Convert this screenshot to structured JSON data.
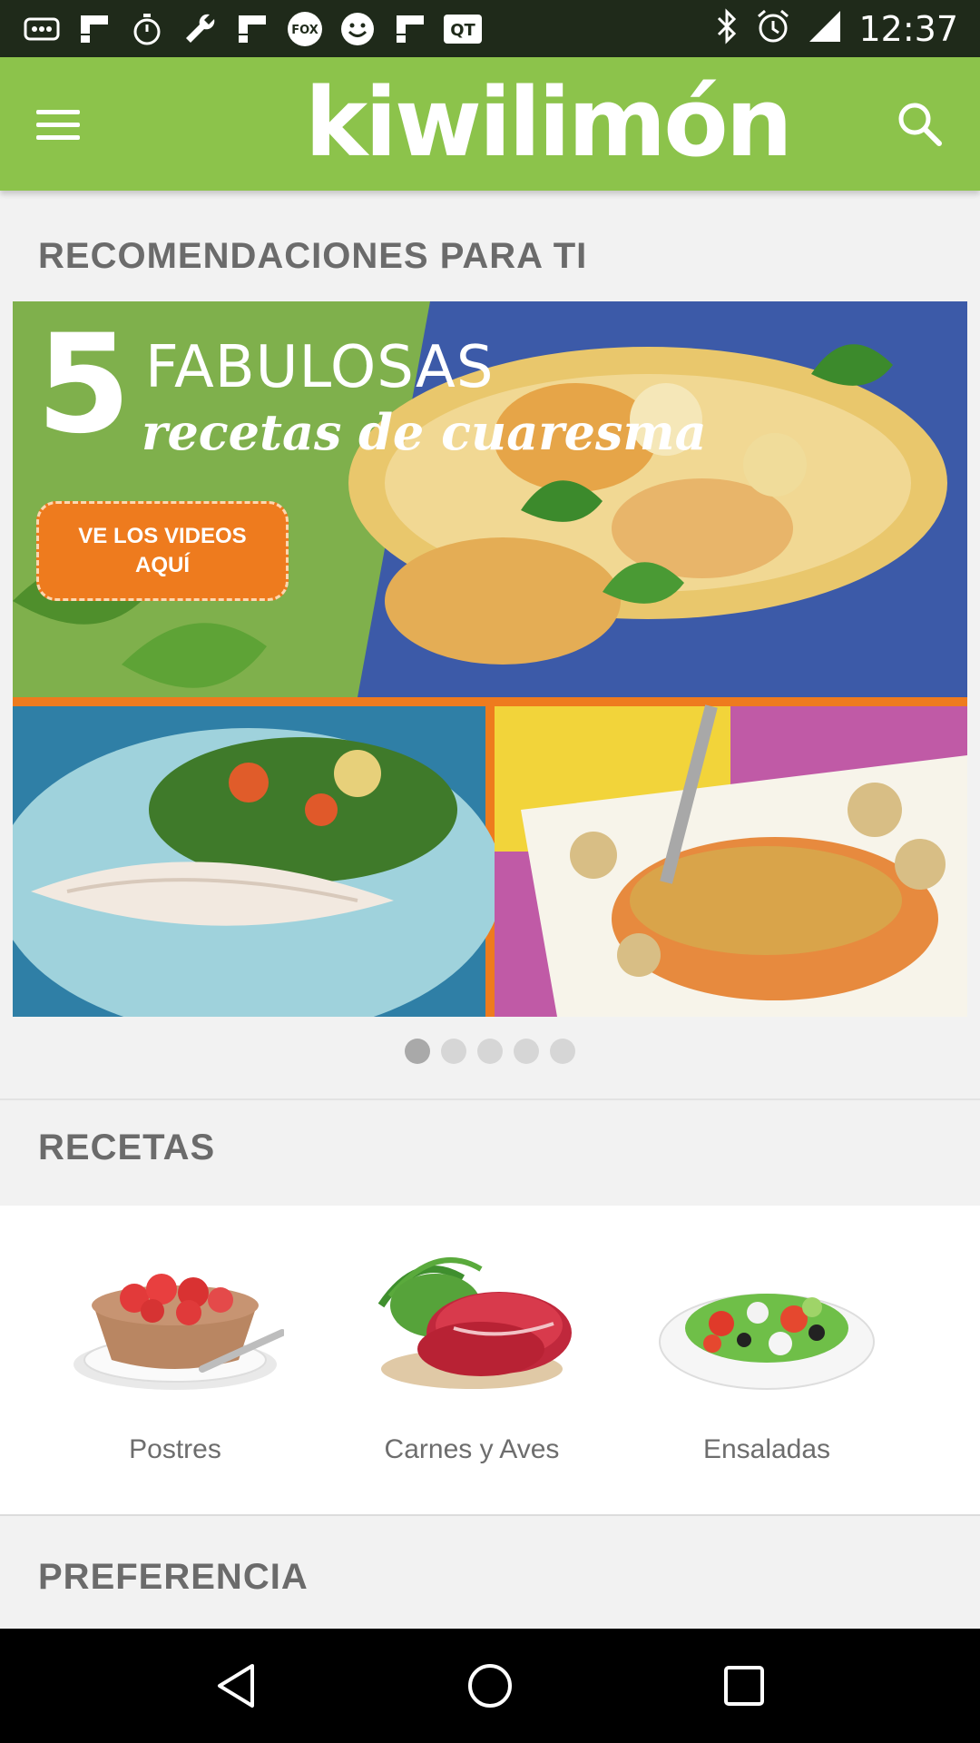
{
  "status_bar": {
    "time": "12:37",
    "icons": [
      "dots-icon",
      "flipboard-icon",
      "stopwatch-icon",
      "wrench-icon",
      "flipboard-icon",
      "fox-sports-icon",
      "smiley-icon",
      "flipboard-icon",
      "qt-icon",
      "bluetooth-icon",
      "alarm-icon",
      "signal-icon"
    ],
    "fox_text": "FOX",
    "qt_text": "QT"
  },
  "app_bar": {
    "logo": "kiwilimón",
    "bg_color": "#8cc34b"
  },
  "recommendations": {
    "title": "RECOMENDACIONES PARA TI",
    "banner": {
      "number": "5",
      "headline": "FABULOSAS",
      "script": "recetas de cuaresma",
      "cta_line1": "VE LOS VIDEOS",
      "cta_line2": "AQUÍ"
    },
    "carousel_pages": 5,
    "carousel_active": 1
  },
  "recipes": {
    "title": "RECETAS",
    "categories": [
      {
        "label": "Postres",
        "icon": "strawberry-dessert-image"
      },
      {
        "label": "Carnes y Aves",
        "icon": "raw-meat-image"
      },
      {
        "label": "Ensaladas",
        "icon": "salad-image"
      }
    ]
  },
  "preferences": {
    "title": "PREFERENCIA"
  },
  "nav_bar": {
    "icons": [
      "back-icon",
      "home-icon",
      "recents-icon"
    ]
  }
}
